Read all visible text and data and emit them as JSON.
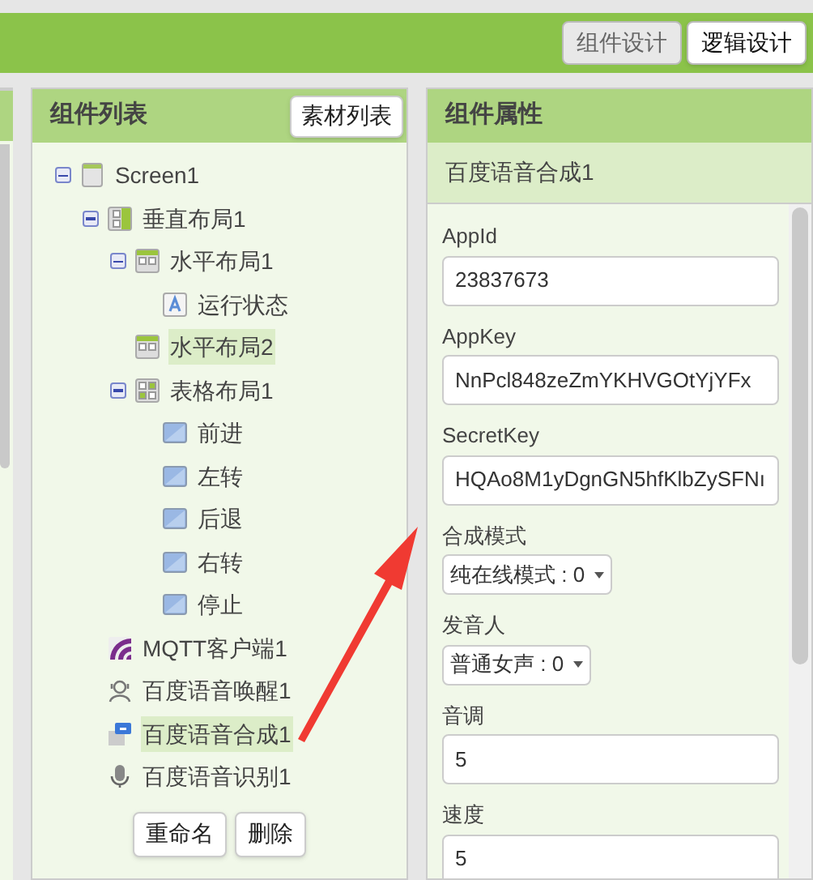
{
  "toolbar": {
    "buttons": [
      {
        "label": "组件设计",
        "selected": true
      },
      {
        "label": "逻辑设计",
        "selected": false
      }
    ]
  },
  "components": {
    "title": "组件列表",
    "media_button": "素材列表",
    "tree": [
      {
        "label": "Screen1",
        "kind": "screen",
        "expanded": true,
        "selected": false,
        "children": [
          {
            "label": "垂直布局1",
            "kind": "vertical",
            "expanded": true,
            "selected": false,
            "children": [
              {
                "label": "水平布局1",
                "kind": "horizontal",
                "expanded": true,
                "selected": false,
                "children": [
                  {
                    "label": "运行状态",
                    "kind": "label",
                    "selected": false
                  }
                ]
              },
              {
                "label": "水平布局2",
                "kind": "horizontal",
                "selected": true
              },
              {
                "label": "表格布局1",
                "kind": "table",
                "expanded": true,
                "selected": false,
                "children": [
                  {
                    "label": "前进",
                    "kind": "button",
                    "selected": false
                  },
                  {
                    "label": "左转",
                    "kind": "button",
                    "selected": false
                  },
                  {
                    "label": "后退",
                    "kind": "button",
                    "selected": false
                  },
                  {
                    "label": "右转",
                    "kind": "button",
                    "selected": false
                  },
                  {
                    "label": "停止",
                    "kind": "button",
                    "selected": false
                  }
                ]
              }
            ]
          },
          {
            "label": "MQTT客户端1",
            "kind": "mqtt",
            "selected": false
          },
          {
            "label": "百度语音唤醒1",
            "kind": "wake",
            "selected": false
          },
          {
            "label": "百度语音合成1",
            "kind": "tts",
            "selected": true
          },
          {
            "label": "百度语音识别1",
            "kind": "mic",
            "selected": false
          }
        ]
      }
    ],
    "buttons": [
      "重命名",
      "删除"
    ]
  },
  "properties": {
    "title": "组件属性",
    "component": "百度语音合成1",
    "fields": [
      {
        "kind": "text",
        "label": "AppId",
        "value": "23837673"
      },
      {
        "kind": "text",
        "label": "AppKey",
        "value": "NnPcl848zeZmYKHVGOtYjYFx"
      },
      {
        "kind": "text",
        "label": "SecretKey",
        "value": "HQAo8M1yDgnGN5hfKlbZySFNı"
      },
      {
        "kind": "dropdown",
        "label": "合成模式",
        "value": "纯在线模式 : 0"
      },
      {
        "kind": "dropdown",
        "label": "发音人",
        "value": "普通女声 : 0"
      },
      {
        "kind": "text",
        "label": "音调",
        "value": "5"
      },
      {
        "kind": "text",
        "label": "速度",
        "value": "5"
      }
    ]
  }
}
